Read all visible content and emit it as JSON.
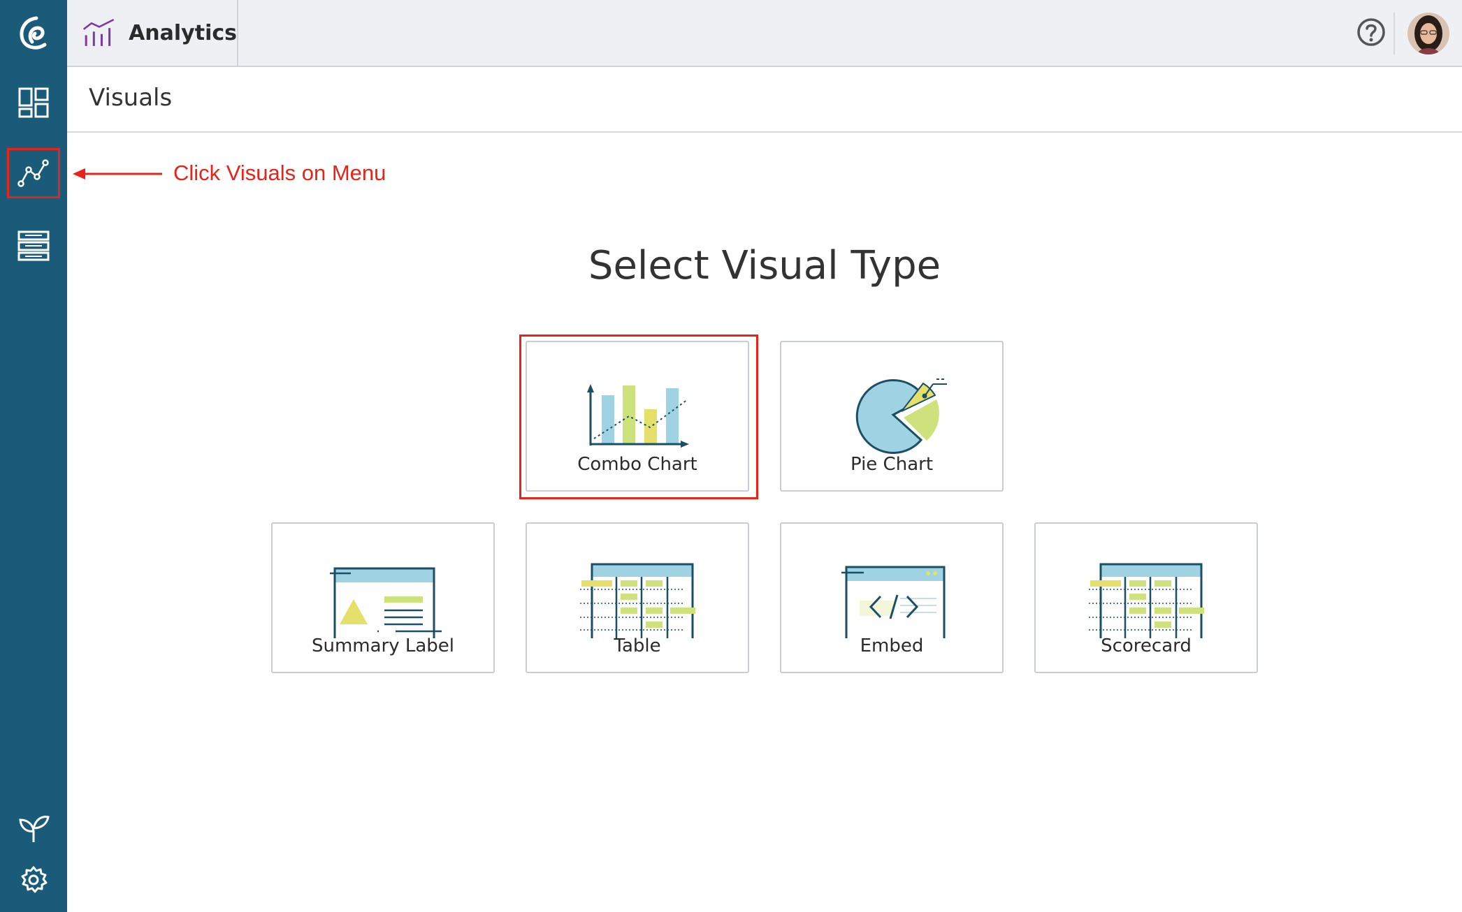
{
  "app": {
    "title": "Analytics"
  },
  "sidebar": {
    "items": [
      {
        "name": "logo-icon"
      },
      {
        "name": "dashboards-icon"
      },
      {
        "name": "visuals-icon"
      },
      {
        "name": "data-sources-icon"
      },
      {
        "name": "sprout-icon"
      },
      {
        "name": "settings-icon"
      }
    ]
  },
  "page": {
    "title": "Visuals"
  },
  "annotation": {
    "text": "Click Visuals on Menu",
    "color": "#e7231a"
  },
  "main": {
    "heading": "Select Visual Type",
    "cards": [
      {
        "label": "Combo Chart",
        "icon": "combo-chart-icon"
      },
      {
        "label": "Pie Chart",
        "icon": "pie-chart-icon"
      },
      {
        "label": "Summary Label",
        "icon": "summary-label-icon"
      },
      {
        "label": "Table",
        "icon": "table-icon"
      },
      {
        "label": "Embed",
        "icon": "embed-icon"
      },
      {
        "label": "Scorecard",
        "icon": "scorecard-icon"
      }
    ]
  },
  "colors": {
    "sidebar": "#1a5b79",
    "accent_blue": "#9fd3e3",
    "accent_yellow": "#e4e069",
    "accent_green": "#cde27d",
    "stroke": "#1a4f66",
    "brand_purple": "#7b3aa0"
  }
}
